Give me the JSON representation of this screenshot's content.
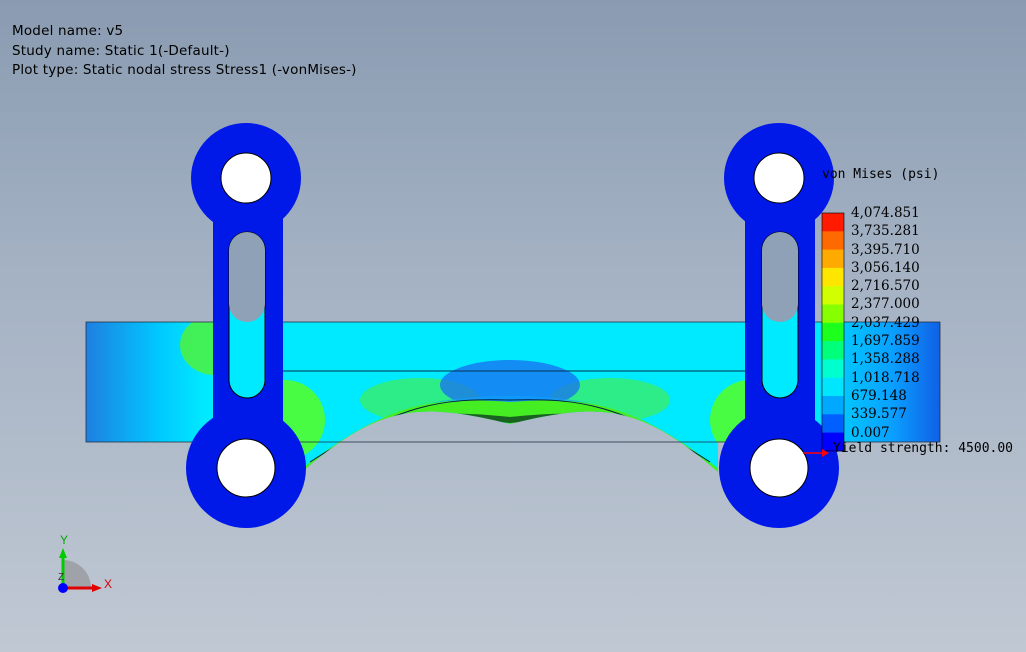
{
  "info": {
    "model_name": "Model name: v5",
    "study_name": "Study name: Static 1(-Default-)",
    "plot_type": "Plot type: Static nodal stress Stress1 (-vonMises-)"
  },
  "legend": {
    "title": "von Mises (psi)",
    "values": [
      "4,074.851",
      "3,735.281",
      "3,395.710",
      "3,056.140",
      "2,716.570",
      "2,377.000",
      "2,037.429",
      "1,697.859",
      "1,358.288",
      "1,018.718",
      "679.148",
      "339.577",
      "0.007"
    ],
    "colors": [
      "#ff1a00",
      "#ff6a00",
      "#ffaa00",
      "#ffe600",
      "#d2ff00",
      "#86ff00",
      "#1dff1d",
      "#00ff7a",
      "#00ffcf",
      "#00e6ff",
      "#00a8ff",
      "#0060ff",
      "#0000ff"
    ],
    "yield_label": "Yield strength: 4500.00"
  },
  "triad": {
    "x_label": "X",
    "y_label": "Y",
    "z_label": "Z"
  },
  "colors": {
    "background_top": "#8a9bb1",
    "background_bottom": "#c0c8d3",
    "link_blue": "#0020ee",
    "low_stress": "#00e8ff",
    "mid_stress": "#33ff22",
    "high_stress": "#cfff00"
  }
}
